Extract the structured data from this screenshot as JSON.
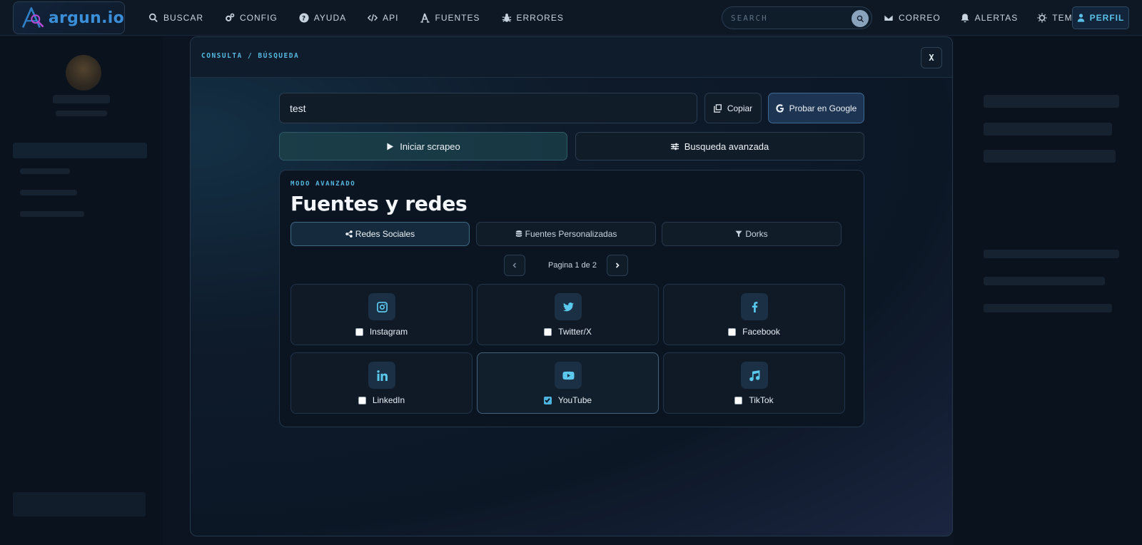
{
  "app": {
    "name": "argun.io"
  },
  "nav": {
    "items": [
      {
        "label": "BUSCAR",
        "icon": "search-icon"
      },
      {
        "label": "CONFIG",
        "icon": "gears-icon"
      },
      {
        "label": "AYUDA",
        "icon": "help-icon"
      },
      {
        "label": "API",
        "icon": "code-icon"
      },
      {
        "label": "FUENTES",
        "icon": "font-icon"
      },
      {
        "label": "ERRORES",
        "icon": "bug-icon"
      }
    ],
    "search_placeholder": "SEARCH",
    "right_items": [
      {
        "label": "CORREO",
        "icon": "envelope-icon"
      },
      {
        "label": "ALERTAS",
        "icon": "bell-icon"
      },
      {
        "label": "TEMA",
        "icon": "sun-icon"
      }
    ],
    "profile_label": "PERFIL"
  },
  "modal": {
    "breadcrumb": "CONSULTA / BÚSQUEDA",
    "close_label": "X",
    "query_value": "test",
    "copy_label": "Copiar",
    "google_label": "Probar en Google",
    "start_label": "Iniciar scrapeo",
    "advanced_label": "Busqueda avanzada",
    "panel": {
      "mode_label": "MODO AVANZADO",
      "title": "Fuentes y redes",
      "tabs": [
        {
          "label": "Redes Sociales",
          "icon": "share-icon",
          "active": true
        },
        {
          "label": "Fuentes Personalizadas",
          "icon": "database-icon",
          "active": false
        },
        {
          "label": "Dorks",
          "icon": "filter-icon",
          "active": false
        }
      ],
      "pager_text": "Pagina 1 de 2",
      "sources": [
        {
          "label": "Instagram",
          "icon": "instagram-icon",
          "checked": false
        },
        {
          "label": "Twitter/X",
          "icon": "twitter-icon",
          "checked": false
        },
        {
          "label": "Facebook",
          "icon": "facebook-icon",
          "checked": false
        },
        {
          "label": "LinkedIn",
          "icon": "linkedin-icon",
          "checked": false
        },
        {
          "label": "YouTube",
          "icon": "youtube-icon",
          "checked": true
        },
        {
          "label": "TikTok",
          "icon": "music-icon",
          "checked": false
        }
      ]
    }
  },
  "colors": {
    "accent": "#55b8e0",
    "background": "#0b1420",
    "icon": "#5bc8ee"
  }
}
